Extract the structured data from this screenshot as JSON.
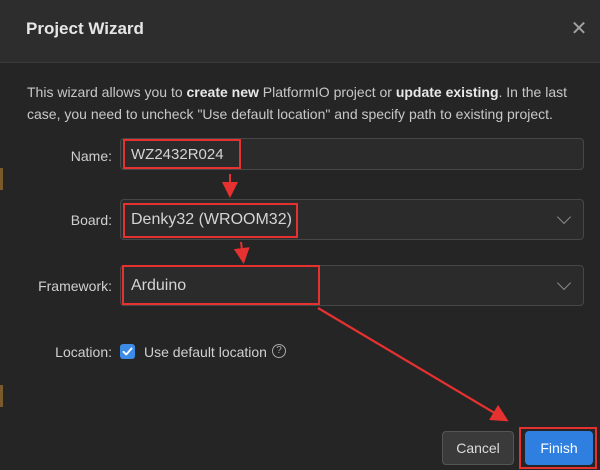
{
  "dialog": {
    "title": "Project Wizard",
    "close_glyph": "✕",
    "description": {
      "p1": "This wizard allows you to ",
      "b1": "create new",
      "p2": " PlatformIO project or ",
      "b2": "update existing",
      "p3": ". In the last case, you need to uncheck \"Use default location\" and specify path to existing project."
    }
  },
  "form": {
    "name": {
      "label": "Name:",
      "value": "WZ2432R024"
    },
    "board": {
      "label": "Board:",
      "value": "Denky32 (WROOM32)"
    },
    "framework": {
      "label": "Framework:",
      "value": "Arduino"
    },
    "location": {
      "label": "Location:",
      "checkbox_label": "Use default location",
      "checked": true,
      "help_glyph": "?"
    }
  },
  "buttons": {
    "cancel": "Cancel",
    "finish": "Finish"
  },
  "icons": {
    "close": "close-icon",
    "chevron": "chevron-down-icon",
    "check": "checkmark-icon",
    "help": "help-icon"
  },
  "colors": {
    "accent": "#2f7fe0",
    "annotation": "#e5312f"
  }
}
